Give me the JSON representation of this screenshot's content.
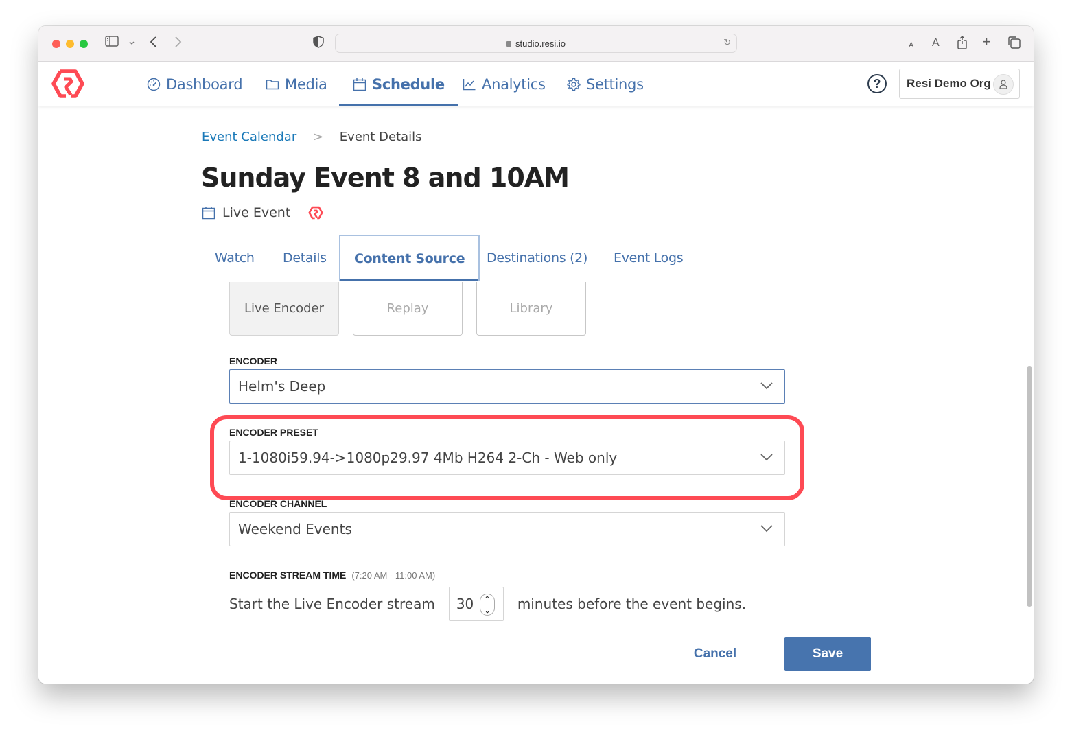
{
  "browser": {
    "url": "studio.resi.io",
    "text_size_small": "A",
    "text_size_large": "A"
  },
  "nav": {
    "items": [
      {
        "label": "Dashboard",
        "icon": "gauge-icon",
        "active": false
      },
      {
        "label": "Media",
        "icon": "folder-icon",
        "active": false
      },
      {
        "label": "Schedule",
        "icon": "calendar-icon",
        "active": true
      },
      {
        "label": "Analytics",
        "icon": "line-chart-icon",
        "active": false
      },
      {
        "label": "Settings",
        "icon": "gear-icon",
        "active": false
      }
    ],
    "help_glyph": "?",
    "org_name": "Resi Demo Org",
    "brand_color": "#fe4a54",
    "accent_color": "#4571ab"
  },
  "breadcrumb": {
    "parent": "Event Calendar",
    "separator": ">",
    "current": "Event Details"
  },
  "event": {
    "title": "Sunday Event 8 and 10AM",
    "type": "Live Event"
  },
  "tabs": [
    {
      "label": "Watch",
      "active": false
    },
    {
      "label": "Details",
      "active": false
    },
    {
      "label": "Content Source",
      "active": true
    },
    {
      "label": "Destinations (2)",
      "active": false
    },
    {
      "label": "Event Logs",
      "active": false
    }
  ],
  "source_options": [
    {
      "label": "Live Encoder",
      "selected": true
    },
    {
      "label": "Replay",
      "selected": false
    },
    {
      "label": "Library",
      "selected": false
    }
  ],
  "form": {
    "encoder": {
      "label": "ENCODER",
      "value": "Helm's Deep"
    },
    "encoder_preset": {
      "label": "ENCODER PRESET",
      "value": "1-1080i59.94->1080p29.97 4Mb H264 2-Ch - Web only",
      "highlighted": true
    },
    "encoder_channel": {
      "label": "ENCODER CHANNEL",
      "value": "Weekend Events"
    },
    "stream_time": {
      "label": "ENCODER STREAM TIME",
      "range": "(7:20 AM - 11:00 AM)",
      "prefix": "Start the Live Encoder stream",
      "minutes": "30",
      "suffix": "minutes before the event begins."
    }
  },
  "footer": {
    "cancel_label": "Cancel",
    "save_label": "Save"
  }
}
